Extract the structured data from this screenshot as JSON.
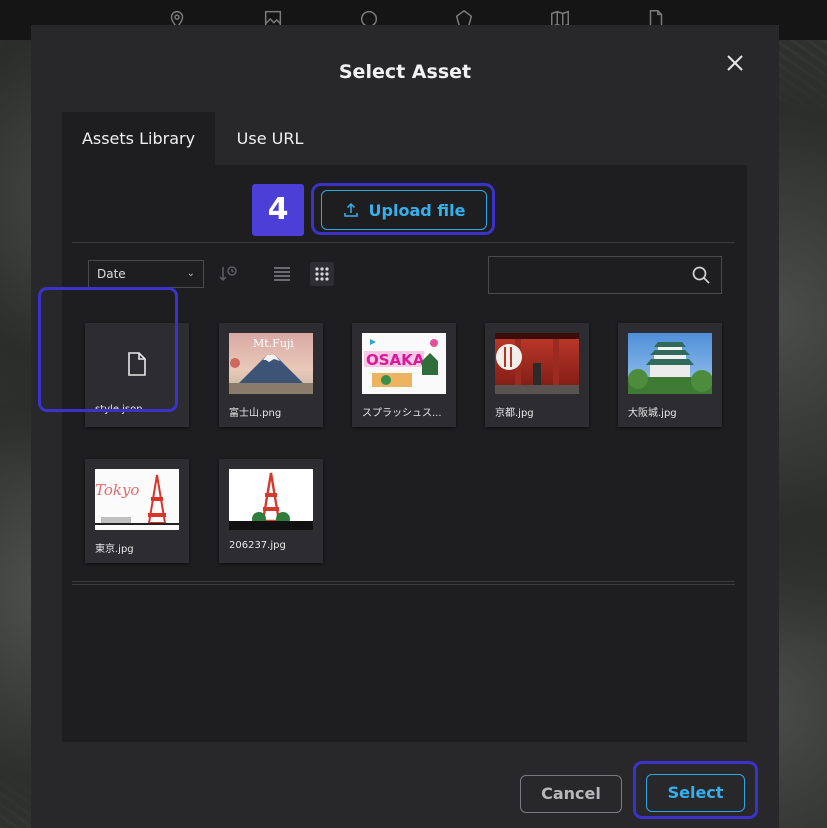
{
  "modal": {
    "title": "Select Asset",
    "tabs": [
      {
        "label": "Assets Library",
        "active": true
      },
      {
        "label": "Use URL",
        "active": false
      }
    ],
    "step_badge": "4",
    "upload_label": "Upload file",
    "sort_select": "Date",
    "search_placeholder": "",
    "assets": [
      {
        "name": "style.json",
        "kind": "file-icon"
      },
      {
        "name": "富士山.png",
        "kind": "image-mt-fuji",
        "thumb_text": "Mt.Fuji"
      },
      {
        "name": "スプラッシュス...",
        "kind": "image-osaka",
        "thumb_text": "OSAKA"
      },
      {
        "name": "京都.jpg",
        "kind": "image-kyoto"
      },
      {
        "name": "大阪城.jpg",
        "kind": "image-osaka-castle"
      },
      {
        "name": "東京.jpg",
        "kind": "image-tokyo",
        "thumb_text": "Tokyo"
      },
      {
        "name": "206237.jpg",
        "kind": "image-tokyo-tower"
      }
    ],
    "cancel_label": "Cancel",
    "select_label": "Select"
  },
  "colors": {
    "accent": "#35b0ef",
    "highlight": "#3b33c9",
    "badge": "#4c3fd8"
  }
}
